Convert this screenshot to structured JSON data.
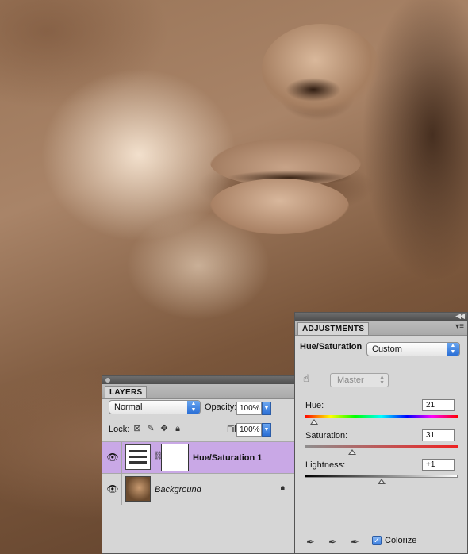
{
  "layers_panel": {
    "tab": "LAYERS",
    "blend_mode": "Normal",
    "opacity_label": "Opacity:",
    "opacity_value": "100%",
    "lock_label": "Lock:",
    "fill_label": "Fill:",
    "fill_value": "100%",
    "layers": [
      {
        "name": "Hue/Saturation 1",
        "selected": true,
        "visible": true
      },
      {
        "name": "Background",
        "selected": false,
        "visible": true,
        "locked": true
      }
    ]
  },
  "adjustments_panel": {
    "tab": "ADJUSTMENTS",
    "title": "Hue/Saturation",
    "preset": "Custom",
    "channel": "Master",
    "hue_label": "Hue:",
    "hue_value": "21",
    "hue_fraction": 0.06,
    "saturation_label": "Saturation:",
    "saturation_value": "31",
    "saturation_fraction": 0.31,
    "lightness_label": "Lightness:",
    "lightness_value": "+1",
    "lightness_fraction": 0.505,
    "colorize_label": "Colorize",
    "colorize_checked": true
  },
  "colors": {
    "selected_layer": "#c9a8e6",
    "panel_bg": "#d6d6d6",
    "sepia_tone": "#9a7558"
  },
  "icons": [
    "eye-icon",
    "chain-link-icon",
    "lock-icon",
    "transparency-lock-icon",
    "brush-lock-icon",
    "move-lock-icon",
    "targeted-adjustment-icon",
    "eyedropper-icon",
    "eyedropper-plus-icon",
    "eyedropper-minus-icon"
  ]
}
